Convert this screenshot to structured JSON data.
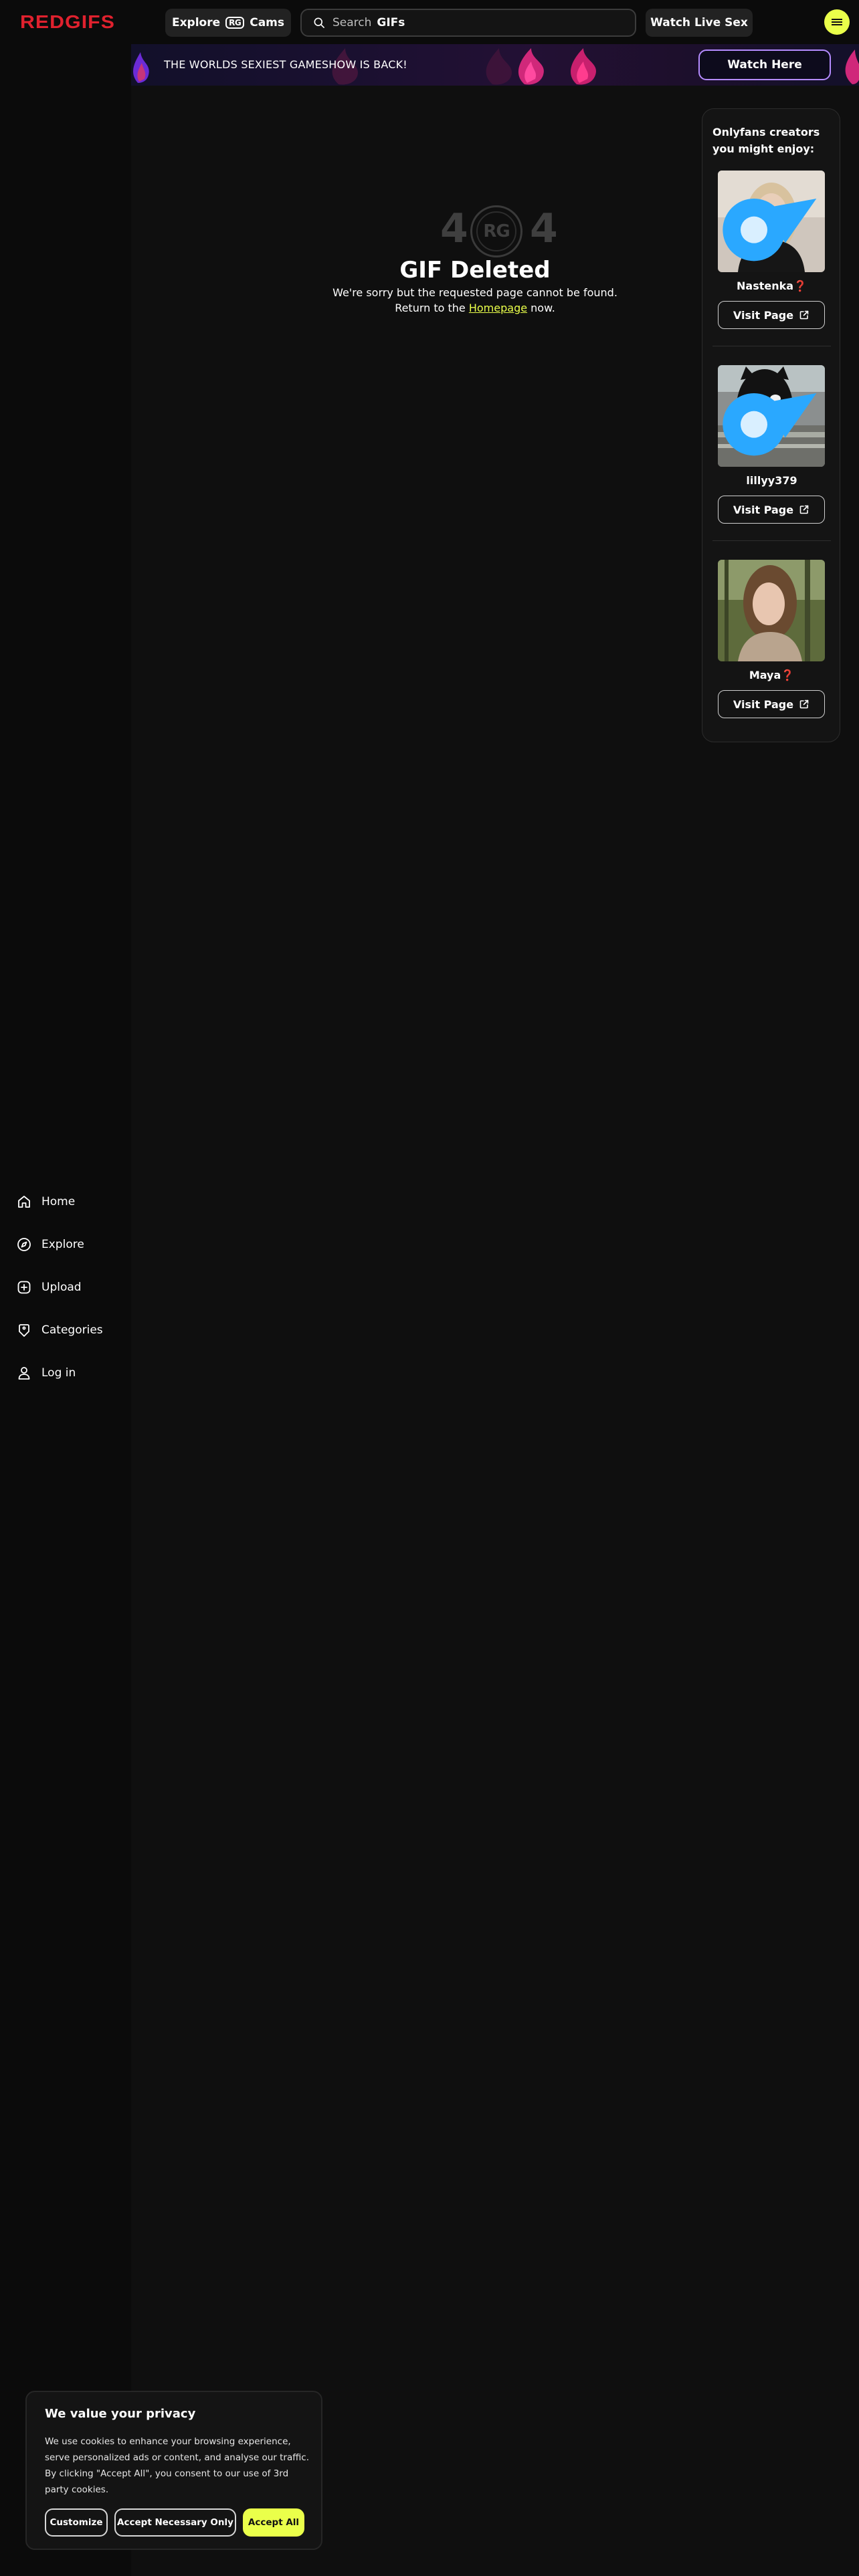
{
  "header": {
    "logo": "REDGIFS",
    "explore_cams": {
      "prefix": "Explore",
      "mark": "RG",
      "suffix": "Cams"
    },
    "search": {
      "placeholder": "Search",
      "scope": "GIFs"
    },
    "watch_live_label": "Watch Live Sex"
  },
  "banner": {
    "text": "THE WORLDS SEXIEST GAMESHOW IS BACK!",
    "button_label": "Watch Here"
  },
  "sidebar": {
    "items": [
      {
        "label": "Home",
        "icon": "home-icon"
      },
      {
        "label": "Explore",
        "icon": "compass-icon"
      },
      {
        "label": "Upload",
        "icon": "upload-plus-icon"
      },
      {
        "label": "Categories",
        "icon": "tag-icon"
      },
      {
        "label": "Log in",
        "icon": "user-icon"
      }
    ]
  },
  "error": {
    "digit_left": "4",
    "logo_mark": "RG",
    "digit_right": "4",
    "title": "GIF Deleted",
    "message_before": "We're sorry but the requested page cannot be found. Return to the ",
    "link_label": "Homepage",
    "message_after": " now."
  },
  "suggestions": {
    "title": "Onlyfans creators you might enjoy:",
    "creators": [
      {
        "name": "Nastenka❓",
        "button_label": "Visit Page"
      },
      {
        "name": "lillyy379",
        "button_label": "Visit Page"
      },
      {
        "name": "Maya❓",
        "button_label": "Visit Page"
      }
    ]
  },
  "cookie": {
    "title": "We value your privacy",
    "text": "We use cookies to enhance your browsing experience, serve personalized ads or content, and analyse our traffic. By clicking \"Accept All\", you consent to our use of 3rd party cookies.",
    "customize_label": "Customize",
    "necessary_label": "Accept Necessary Only",
    "accept_label": "Accept All"
  },
  "colors": {
    "brand_red": "#e0212e",
    "accent_yellow": "#eaff4a",
    "banner_border": "#b58cff",
    "background": "#0f0f0f"
  }
}
